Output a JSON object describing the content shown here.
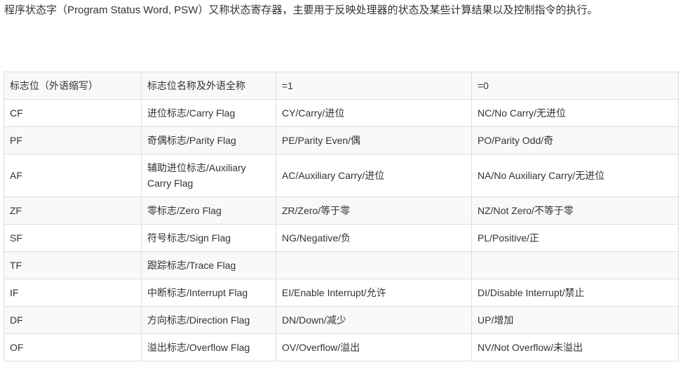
{
  "intro": "程序状态字（Program Status Word, PSW）又称状态寄存器，主要用于反映处理器的状态及某些计算结果以及控制指令的执行。",
  "table": {
    "headers": [
      "标志位（外语缩写）",
      "标志位名称及外语全称",
      "=1",
      "=0"
    ],
    "rows": [
      [
        "CF",
        "进位标志/Carry Flag",
        "CY/Carry/进位",
        "NC/No Carry/无进位"
      ],
      [
        "PF",
        "奇偶标志/Parity Flag",
        "PE/Parity Even/偶",
        "PO/Parity Odd/奇"
      ],
      [
        "AF",
        "辅助进位标志/Auxiliary Carry Flag",
        "AC/Auxiliary Carry/进位",
        "NA/No Auxiliary Carry/无进位"
      ],
      [
        "ZF",
        "零标志/Zero Flag",
        "ZR/Zero/等于零",
        "NZ/Not Zero/不等于零"
      ],
      [
        "SF",
        "符号标志/Sign Flag",
        "NG/Negative/负",
        "PL/Positive/正"
      ],
      [
        "TF",
        "跟踪标志/Trace Flag",
        "",
        ""
      ],
      [
        "IF",
        "中断标志/Interrupt Flag",
        "EI/Enable Interrupt/允许",
        "DI/Disable Interrupt/禁止"
      ],
      [
        "DF",
        "方向标志/Direction Flag",
        "DN/Down/减少",
        "UP/增加"
      ],
      [
        "OF",
        "溢出标志/Overflow Flag",
        "OV/Overflow/溢出",
        "NV/Not Overflow/未溢出"
      ]
    ]
  }
}
